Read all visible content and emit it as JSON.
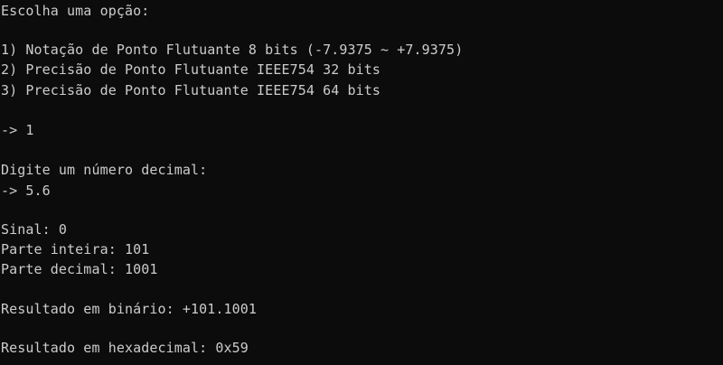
{
  "console": {
    "menu_prompt": "Escolha uma opção:",
    "options": [
      "1) Notação de Ponto Flutuante 8 bits (-7.9375 ~ +7.9375)",
      "2) Precisão de Ponto Flutuante IEEE754 32 bits",
      "3) Precisão de Ponto Flutuante IEEE754 64 bits"
    ],
    "option_input": "-> 1",
    "decimal_prompt": "Digite um número decimal:",
    "decimal_input": "-> 5.6",
    "sign": "Sinal: 0",
    "integer_part": "Parte inteira: 101",
    "decimal_part": "Parte decimal: 1001",
    "binary_result": "Resultado em binário: +101.1001",
    "hex_result": "Resultado em hexadecimal: 0x59"
  },
  "colors": {
    "background": "#0c0c0c",
    "text": "#cccccc"
  }
}
